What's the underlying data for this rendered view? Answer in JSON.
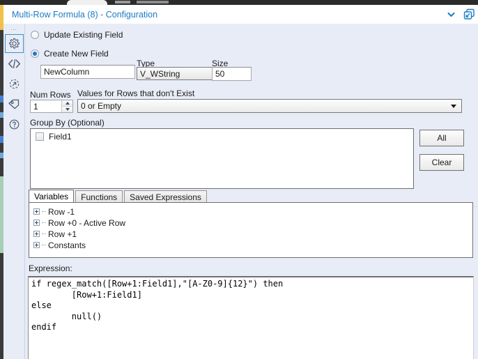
{
  "window": {
    "title": "Multi-Row Formula (8) - Configuration",
    "title_color": "#1a7bc4",
    "collapse_icon": "chevron-down-icon",
    "expand_icon": "open-in-new-window-icon"
  },
  "rail": {
    "handle": "⋯",
    "items": [
      {
        "icon": "gear-icon",
        "name": "configuration",
        "active": true
      },
      {
        "icon": "code-brackets-icon",
        "name": "xml-view",
        "active": false
      },
      {
        "icon": "circular-arrow-icon",
        "name": "runtime",
        "active": false
      },
      {
        "icon": "tag-icon",
        "name": "annotation",
        "active": false
      },
      {
        "icon": "question-mark-icon",
        "name": "help",
        "active": false
      }
    ]
  },
  "output_mode": {
    "update_existing": {
      "label": "Update Existing Field",
      "selected": false
    },
    "create_new": {
      "label": "Create New  Field",
      "selected": true
    }
  },
  "new_field": {
    "name_value": "NewColumn",
    "name_placeholder": "",
    "type_label": "Type",
    "type_value": "V_WString",
    "size_label": "Size",
    "size_value": "50"
  },
  "num_rows": {
    "label": "Num Rows",
    "value": "1"
  },
  "values_for_rows": {
    "label": "Values for Rows that don't Exist",
    "value": "0 or Empty"
  },
  "group_by": {
    "label": "Group By (Optional)",
    "fields": [
      {
        "label": "Field1",
        "checked": false
      }
    ],
    "all_button": "All",
    "clear_button": "Clear"
  },
  "tabs": [
    {
      "label": "Variables",
      "active": true
    },
    {
      "label": "Functions",
      "active": false
    },
    {
      "label": "Saved Expressions",
      "active": false
    }
  ],
  "variables_tree": [
    {
      "label": "Row -1"
    },
    {
      "label": "Row +0 - Active Row"
    },
    {
      "label": "Row +1"
    },
    {
      "label": "Constants"
    }
  ],
  "expression": {
    "label": "Expression:",
    "text": "if regex_match([Row+1:Field1],\"[A-Z0-9]{12}\") then\n        [Row+1:Field1]\nelse\n        null()\nendif"
  },
  "colors": {
    "panel_bg": "#e8ecf7",
    "accent": "#1a7bc4",
    "radio_fill": "#2179c4",
    "text": "#1a1a1a"
  }
}
